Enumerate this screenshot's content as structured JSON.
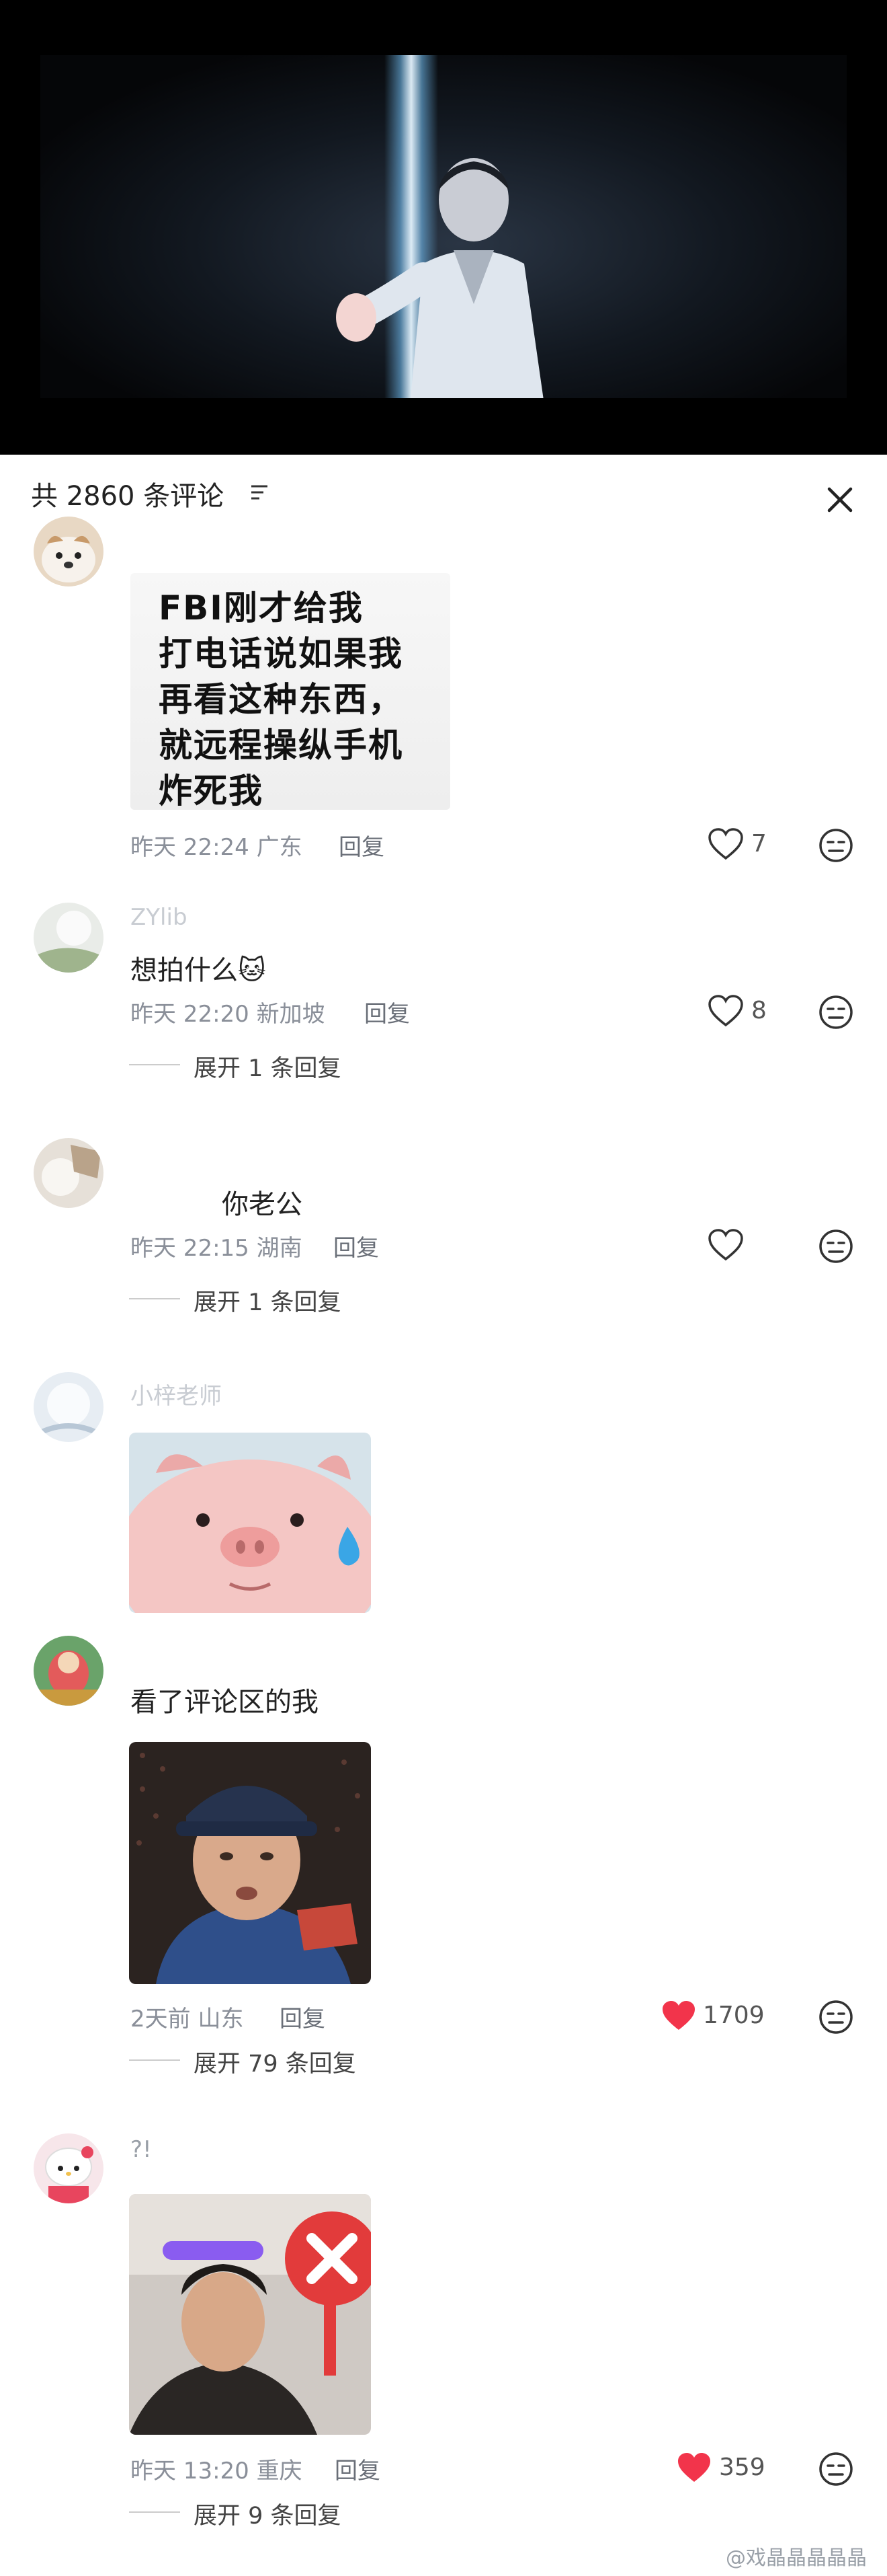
{
  "header": {
    "title": "共 2860 条评论"
  },
  "comments": [
    {
      "image_text": [
        "FBI刚才给我",
        "打电话说如果我",
        "再看这种东西，",
        "就远程操纵手机",
        "炸死我"
      ],
      "time": "昨天 22:24 广东",
      "reply_label": "回复",
      "likes": "7"
    },
    {
      "username": "ZYlib",
      "text": "想拍什么🐱",
      "time": "昨天 22:20 新加坡",
      "reply_label": "回复",
      "likes": "8",
      "expand": "展开 1 条回复"
    },
    {
      "text": "你老公",
      "time": "昨天 22:15 湖南",
      "reply_label": "回复",
      "likes": "",
      "expand": "展开 1 条回复"
    },
    {
      "username": "小梓老师",
      "image": "pig-crying-sticker"
    },
    {
      "text": "看了评论区的我",
      "image": "zhao-benshan-meme",
      "time": "2天前 山东",
      "reply_label": "回复",
      "likes": "1709",
      "expand": "展开 79 条回复"
    },
    {
      "username": "?!",
      "image": "guy-with-x-sign-meme",
      "time": "昨天 13:20 重庆",
      "reply_label": "回复",
      "likes": "359",
      "expand": "展开 9 条回复"
    }
  ],
  "watermark": "@戏晶晶晶晶晶",
  "colors": {
    "liked": "#f2344b",
    "meta": "#8a8f99",
    "accent_beam": "#8fd0ff"
  }
}
